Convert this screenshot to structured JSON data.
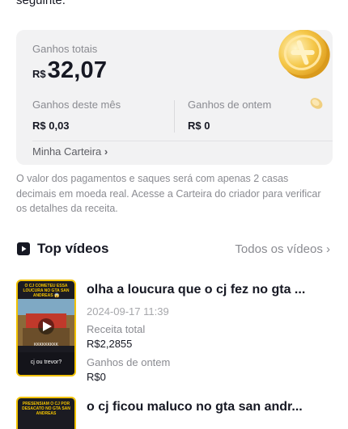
{
  "intro": {
    "tail_text": "seguinte."
  },
  "earnings": {
    "total_label": "Ganhos totais",
    "currency": "R$",
    "total_value": "32,07",
    "month_label": "Ganhos deste mês",
    "month_value": "R$ 0,03",
    "yesterday_label": "Ganhos de ontem",
    "yesterday_value": "R$ 0",
    "wallet_link": "Minha Carteira",
    "wallet_chevron": "›"
  },
  "note": "O valor dos pagamentos e saques será com apenas 2 casas decimais em moeda real. Acesse a Carteira do criador para verificar os detalhes da receita.",
  "top_videos": {
    "title": "Top vídeos",
    "all_label": "Todos os vídeos",
    "all_chevron": "›",
    "items": [
      {
        "title": "olha a loucura que o cj fez no gta ...",
        "date": "2024-09-17 11:39",
        "revenue_label": "Receita total",
        "revenue_value": "R$2,2855",
        "yesterday_label": "Ganhos de ontem",
        "yesterday_value": "R$0",
        "thumb_caption_top": "O CJ COMETEU ESSA LOUCURA NO GTA SAN ANDREAS 😱",
        "thumb_caption_mid": "KKKKKKKKK",
        "thumb_caption_bottom": "cj ou trevor?"
      },
      {
        "title": "o cj ficou maluco no gta san andr...",
        "thumb_caption_top": "PRESENSIAM O CJ POR DESACATO NO GTA SAN ANDREAS"
      }
    ]
  },
  "icons": {
    "video_section": "play-square-icon",
    "coin": "coin-icon"
  },
  "colors": {
    "accent_border": "#f2c200",
    "card_bg": "#f2f2f3"
  }
}
